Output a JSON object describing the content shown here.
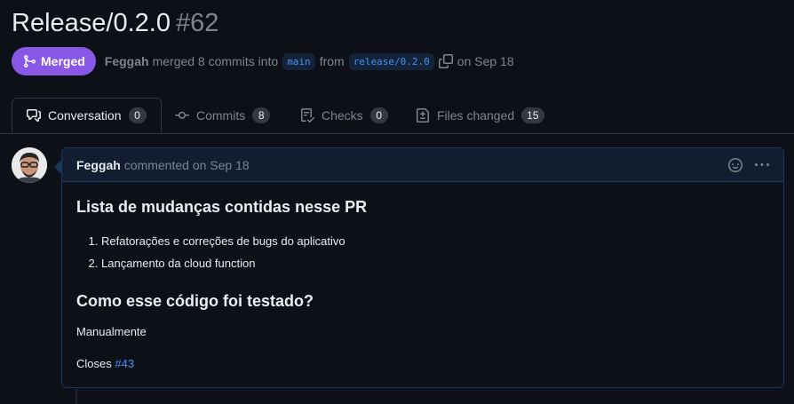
{
  "pr": {
    "title": "Release/0.2.0",
    "number": "#62",
    "state": "Merged",
    "author": "Feggah",
    "merged_text": "merged 8 commits into",
    "base_branch": "main",
    "from_text": "from",
    "head_branch": "release/0.2.0",
    "date_text": "on Sep 18"
  },
  "tabs": [
    {
      "label": "Conversation",
      "count": "0",
      "icon": "comment-discussion-icon"
    },
    {
      "label": "Commits",
      "count": "8",
      "icon": "commit-icon"
    },
    {
      "label": "Checks",
      "count": "0",
      "icon": "checklist-icon"
    },
    {
      "label": "Files changed",
      "count": "15",
      "icon": "file-diff-icon"
    }
  ],
  "comment": {
    "author": "Feggah",
    "meta": "commented on Sep 18",
    "heading1": "Lista de mudanças contidas nesse PR",
    "list": [
      "Refatorações e correções de bugs do aplicativo",
      "Lançamento da cloud function"
    ],
    "heading2": "Como esse código foi testado?",
    "paragraph": "Manualmente",
    "closes_label": "Closes",
    "closes_link": "#43"
  },
  "colors": {
    "merged": "#8957e5",
    "link": "#4493f8",
    "background": "#0d1117"
  }
}
